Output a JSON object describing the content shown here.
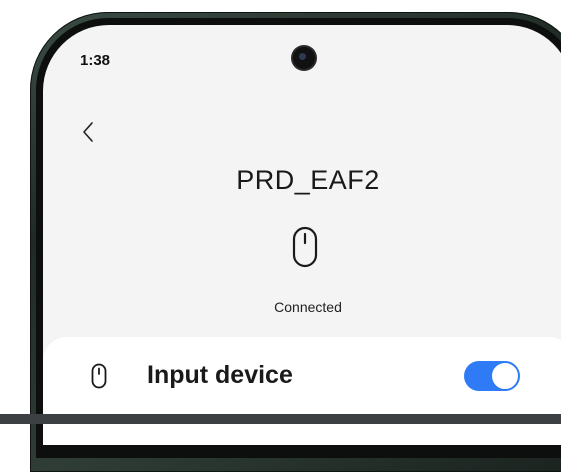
{
  "status_bar": {
    "time": "1:38"
  },
  "header": {
    "back_icon": "chevron-left-icon"
  },
  "device": {
    "name": "PRD_EAF2",
    "icon": "mouse-icon",
    "status": "Connected"
  },
  "settings": {
    "input_device": {
      "icon": "mouse-icon",
      "label": "Input device",
      "enabled": true
    }
  },
  "colors": {
    "accent": "#2f7bf5",
    "screen_background": "#f4f4f4",
    "card_background": "#ffffff",
    "phone_frame": "#2f3d36"
  }
}
